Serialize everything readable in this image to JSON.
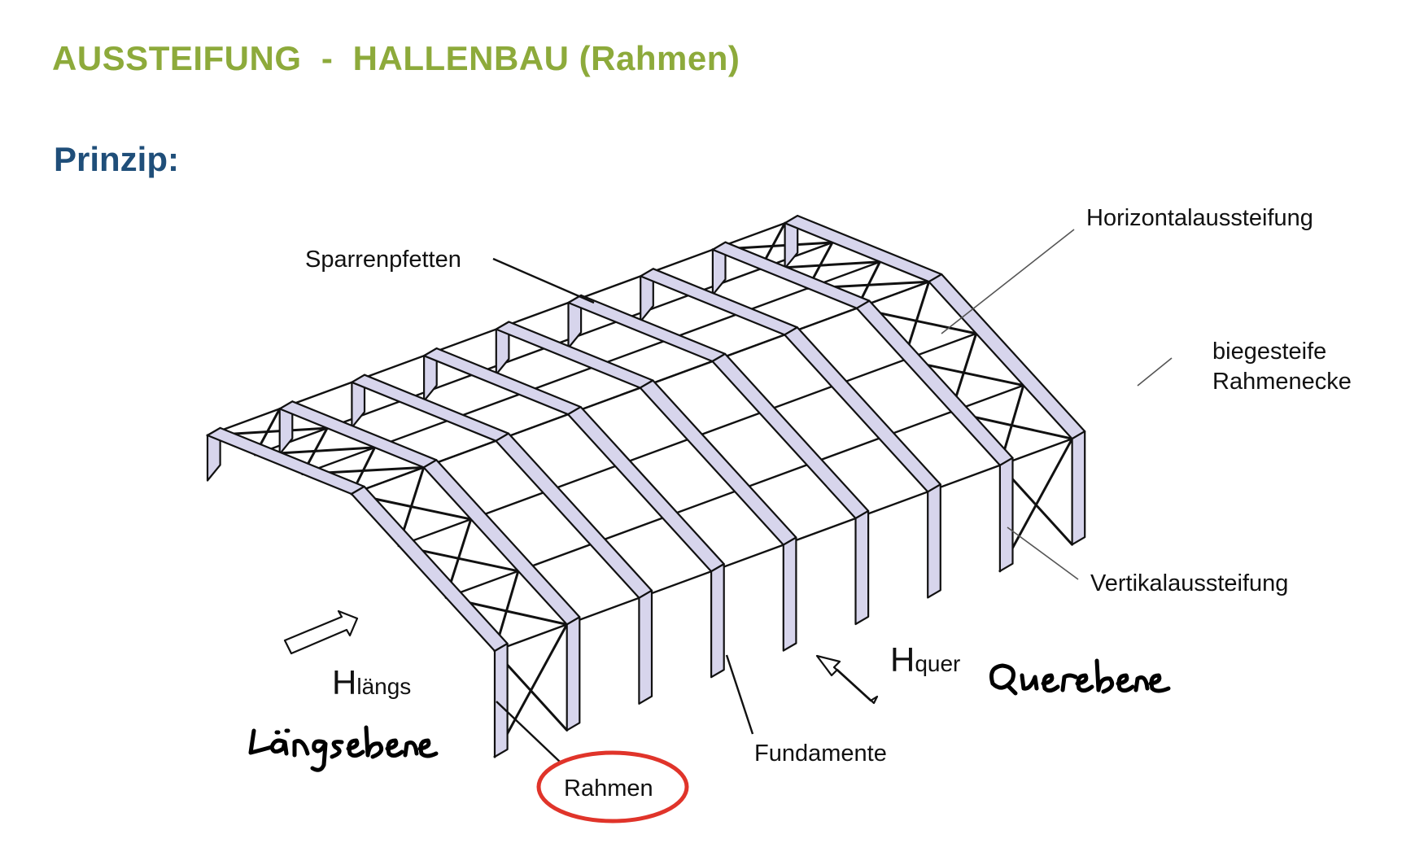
{
  "header": {
    "title": "AUSSTEIFUNG  -  HALLENBAU (Rahmen)",
    "subtitle": "Prinzip:"
  },
  "colors": {
    "title": "#8daa3b",
    "subtitle": "#1f4e79",
    "frame_fill": "#d7d5ec",
    "line": "#111111",
    "highlight_circle": "#e0342a"
  },
  "labels": {
    "sparrenpfetten": "Sparrenpfetten",
    "horizontalaussteifung": "Horizontalaussteifung",
    "rahmenecke_line1": "biegesteife",
    "rahmenecke_line2": "Rahmenecke",
    "vertikalaussteifung": "Vertikalaussteifung",
    "fundamente": "Fundamente",
    "rahmen": "Rahmen"
  },
  "forces": {
    "h_laengs_main": "H",
    "h_laengs_sub": "längs",
    "h_quer_main": "H",
    "h_quer_sub": "quer"
  },
  "handwriting": {
    "laengsebene": "Längsebene",
    "querebene": "Querebene"
  }
}
